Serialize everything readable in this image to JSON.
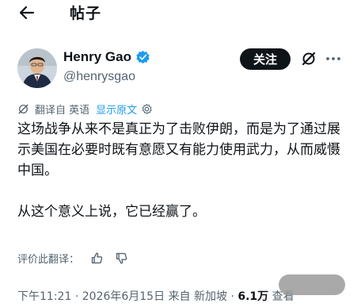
{
  "header": {
    "title": "帖子"
  },
  "post": {
    "author": {
      "display_name": "Henry Gao",
      "handle": "@henrysgao"
    },
    "follow_label": "关注",
    "translation": {
      "from_text": "翻译自 英语",
      "show_original": "显示原文"
    },
    "paragraph_1": "这场战争从来不是真正为了击败伊朗，而是为了通过展示美国在必要时既有意愿又有能力使用武力，从而威慑中国。",
    "paragraph_2": "从这个意义上说，它已经赢了。",
    "rate_translation": "评价此翻译：",
    "meta": {
      "time": "下午11:21",
      "date": "2026年6月15日",
      "location": "来自 新加坡",
      "views": "6.1万",
      "views_label": "查看"
    }
  },
  "colors": {
    "accent": "#1d9bf0",
    "text": "#0f1419",
    "secondary": "#536471"
  }
}
